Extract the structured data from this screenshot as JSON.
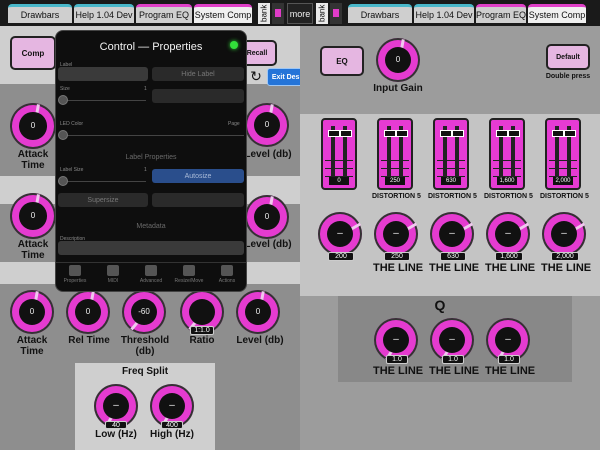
{
  "topbar": {
    "left_tabs": [
      "Drawbars",
      "Help 1.04 Dev",
      "Program EQ",
      "System Comp"
    ],
    "right_tabs": [
      "Drawbars",
      "Help 1.04 Dev",
      "Program EQ",
      "System Comp"
    ],
    "bank_label": "bank",
    "more_label": "more"
  },
  "left": {
    "comp_button": "Comp",
    "recall_button": "Recall",
    "rows": [
      {
        "knobs": [
          {
            "value": "0",
            "label": "Attack Time"
          },
          {
            "value": "0",
            "label": "Level (db)"
          }
        ]
      },
      {
        "knobs": [
          {
            "value": "0",
            "label": "Attack Time"
          },
          {
            "value": "0",
            "label": "Level (db)"
          }
        ]
      },
      {
        "knobs": [
          {
            "value": "0",
            "label": "Attack Time"
          },
          {
            "value": "0",
            "label": "Rel Time"
          },
          {
            "value": "-60",
            "label": "Threshold (db)"
          },
          {
            "value": "1:1.0",
            "label": "Ratio"
          },
          {
            "value": "0",
            "label": "Level (db)"
          }
        ]
      }
    ],
    "freq_split": {
      "title": "Freq Split",
      "knobs": [
        {
          "value": "40",
          "label": "Low (Hz)"
        },
        {
          "value": "400",
          "label": "High (Hz)"
        }
      ]
    }
  },
  "overlay": {
    "title": "Control — Properties",
    "label_caption": "Label",
    "hide_label": "Hide Label",
    "size_caption": "Size",
    "size_value": "1",
    "led_color": "LED Color",
    "page_caption": "Page",
    "label_properties": "Label Properties",
    "label_size": "Label Size",
    "label_size_value": "1",
    "autosize": "Autosize",
    "supersize": "Supersize",
    "metadata": "Metadata",
    "description": "Description",
    "tabs": [
      "Properties",
      "MIDI",
      "Advanced",
      "Resize/Move",
      "Actions"
    ]
  },
  "design": {
    "exit_button": "Exit Design Mode"
  },
  "right": {
    "eq_button": "EQ",
    "default_button": "Default",
    "double_press": "Double press",
    "input_gain": {
      "value": "0",
      "label": "Input Gain"
    },
    "faders": [
      {
        "value": "0",
        "label": ""
      },
      {
        "value": "250",
        "label": "DISTORTION 5"
      },
      {
        "value": "630",
        "label": "DISTORTION 5"
      },
      {
        "value": "1,600",
        "label": "DISTORTION 5"
      },
      {
        "value": "2,000",
        "label": "DISTORTION 5"
      }
    ],
    "freq_knobs": [
      {
        "value": "200",
        "label": ""
      },
      {
        "value": "250",
        "label": "THE LINE"
      },
      {
        "value": "630",
        "label": "THE LINE"
      },
      {
        "value": "1,600",
        "label": "THE LINE"
      },
      {
        "value": "2,000",
        "label": "THE LINE"
      }
    ],
    "q_title": "Q",
    "q_knobs": [
      {
        "value": "1.0",
        "label": "THE LINE"
      },
      {
        "value": "1.0",
        "label": "THE LINE"
      },
      {
        "value": "1.0",
        "label": "THE LINE"
      }
    ]
  },
  "colors": {
    "accent": "#e53bd0",
    "design_blue": "#2474d8",
    "led_green": "#32e03a"
  }
}
